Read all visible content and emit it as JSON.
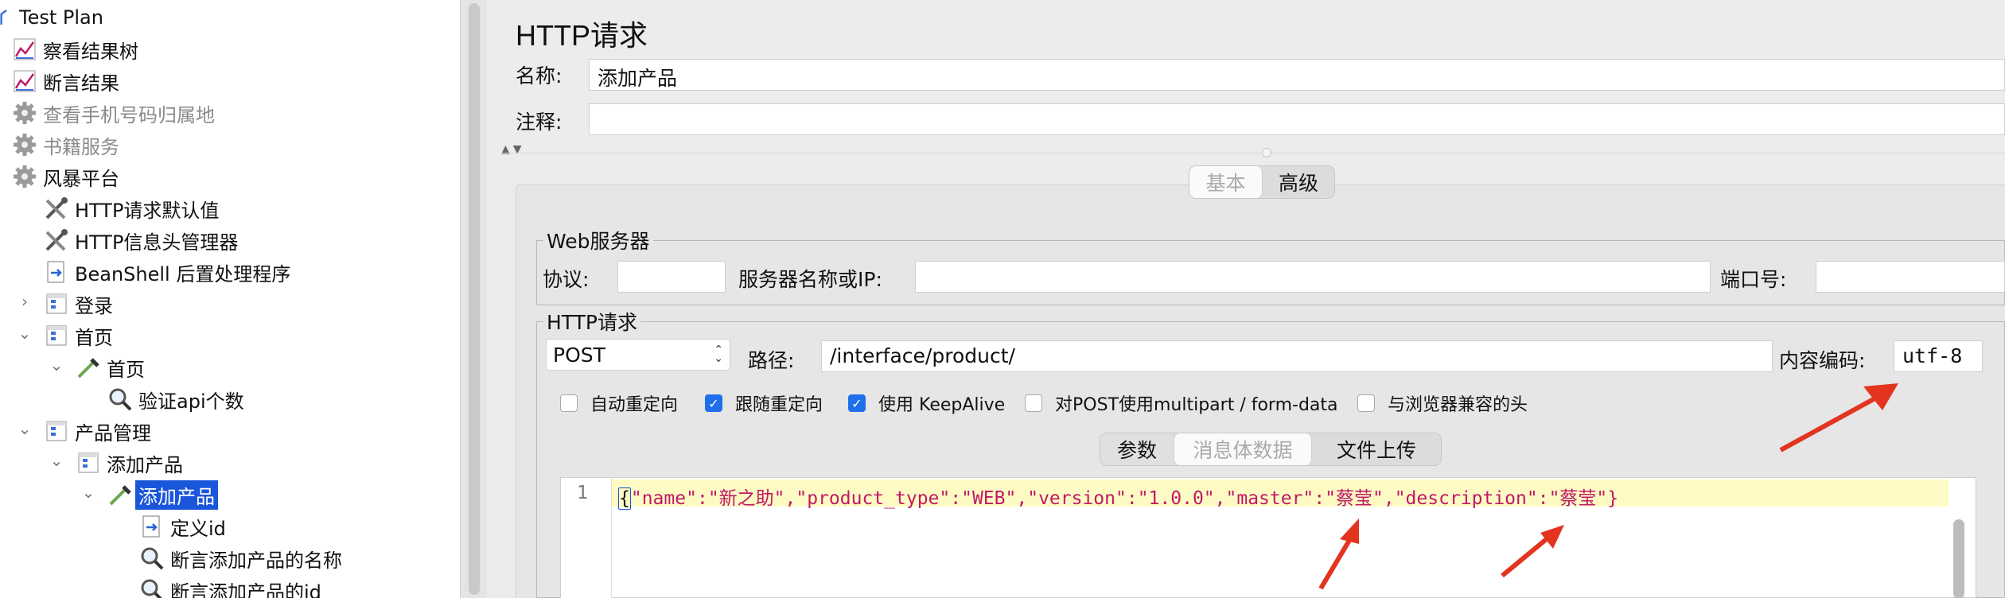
{
  "tree": {
    "items": [
      {
        "label": "Test Plan",
        "icon": "testplan-icon",
        "state": "normal"
      },
      {
        "label": "察看结果树",
        "icon": "graph-listener-icon",
        "state": "normal"
      },
      {
        "label": "断言结果",
        "icon": "graph-listener-icon",
        "state": "normal"
      },
      {
        "label": "查看手机号码归属地",
        "icon": "gear-icon",
        "state": "disabled"
      },
      {
        "label": "书籍服务",
        "icon": "gear-icon",
        "state": "disabled"
      },
      {
        "label": "风暴平台",
        "icon": "gear-icon",
        "state": "normal"
      },
      {
        "label": "HTTP请求默认值",
        "icon": "wrench-icon",
        "state": "normal"
      },
      {
        "label": "HTTP信息头管理器",
        "icon": "wrench-icon",
        "state": "normal"
      },
      {
        "label": "BeanShell 后置处理程序",
        "icon": "script-icon",
        "state": "normal"
      },
      {
        "label": "登录",
        "icon": "controller-icon",
        "state": "collapsed"
      },
      {
        "label": "首页",
        "icon": "controller-icon",
        "state": "expanded"
      },
      {
        "label": "首页",
        "icon": "pipette-sampler-icon",
        "state": "expanded"
      },
      {
        "label": "验证api个数",
        "icon": "magnifier-icon",
        "state": "normal"
      },
      {
        "label": "产品管理",
        "icon": "controller-icon",
        "state": "expanded"
      },
      {
        "label": "添加产品",
        "icon": "controller-icon",
        "state": "expanded"
      },
      {
        "label": "添加产品",
        "icon": "pipette-sampler-icon",
        "state": "selected"
      },
      {
        "label": "定义id",
        "icon": "script-icon",
        "state": "normal"
      },
      {
        "label": "断言添加产品的名称",
        "icon": "magnifier-icon",
        "state": "normal"
      },
      {
        "label": "断言添加产品的id",
        "icon": "magnifier-icon",
        "state": "normal"
      }
    ]
  },
  "panel": {
    "title": "HTTP请求",
    "name_label": "名称:",
    "name_value": "添加产品",
    "comment_label": "注释:",
    "comment_value": ""
  },
  "tabs": {
    "basic": "基本",
    "advanced": "高级",
    "active": "basic"
  },
  "web_server": {
    "legend": "Web服务器",
    "protocol_label": "协议:",
    "protocol_value": "",
    "server_label": "服务器名称或IP:",
    "server_value": "",
    "port_label": "端口号:",
    "port_value": ""
  },
  "http_request": {
    "legend": "HTTP请求",
    "method": "POST",
    "path_label": "路径:",
    "path_value": "/interface/product/",
    "encoding_label": "内容编码:",
    "encoding_value": "utf-8"
  },
  "options": [
    {
      "label": "自动重定向",
      "checked": false
    },
    {
      "label": "跟随重定向",
      "checked": true
    },
    {
      "label": "使用 KeepAlive",
      "checked": true
    },
    {
      "label": "对POST使用multipart / form-data",
      "checked": false
    },
    {
      "label": "与浏览器兼容的头",
      "checked": false
    }
  ],
  "body_tabs": {
    "params": "参数",
    "body": "消息体数据",
    "files": "文件上传",
    "active": "body"
  },
  "editor": {
    "line_number": "1",
    "body_text": "{\"name\":\"新之助\",\"product_type\":\"WEB\",\"version\":\"1.0.0\",\"master\":\"蔡莹\",\"description\":\"蔡莹\"}",
    "tokens": [
      {
        "t": "{",
        "c": "brace-cursor"
      },
      {
        "t": "\"name\"",
        "c": "key"
      },
      {
        "t": ":",
        "c": "punct"
      },
      {
        "t": "\"新之助\"",
        "c": "str"
      },
      {
        "t": ",",
        "c": "punct"
      },
      {
        "t": "\"product_type\"",
        "c": "key"
      },
      {
        "t": ":",
        "c": "punct"
      },
      {
        "t": "\"WEB\"",
        "c": "str"
      },
      {
        "t": ",",
        "c": "punct"
      },
      {
        "t": "\"version\"",
        "c": "key"
      },
      {
        "t": ":",
        "c": "punct"
      },
      {
        "t": "\"1.0.0\"",
        "c": "str"
      },
      {
        "t": ",",
        "c": "punct"
      },
      {
        "t": "\"master\"",
        "c": "key"
      },
      {
        "t": ":",
        "c": "punct"
      },
      {
        "t": "\"蔡莹\"",
        "c": "str"
      },
      {
        "t": ",",
        "c": "punct"
      },
      {
        "t": "\"description\"",
        "c": "key"
      },
      {
        "t": ":",
        "c": "punct"
      },
      {
        "t": "\"蔡莹\"",
        "c": "str"
      },
      {
        "t": "}",
        "c": "str"
      }
    ]
  },
  "colors": {
    "selection": "#1a56d9",
    "annotation_arrow": "#e3341f",
    "json_text": "#c0196a",
    "editor_line_highlight": "#fdfbc3",
    "checkbox_checked": "#1f6feb"
  }
}
